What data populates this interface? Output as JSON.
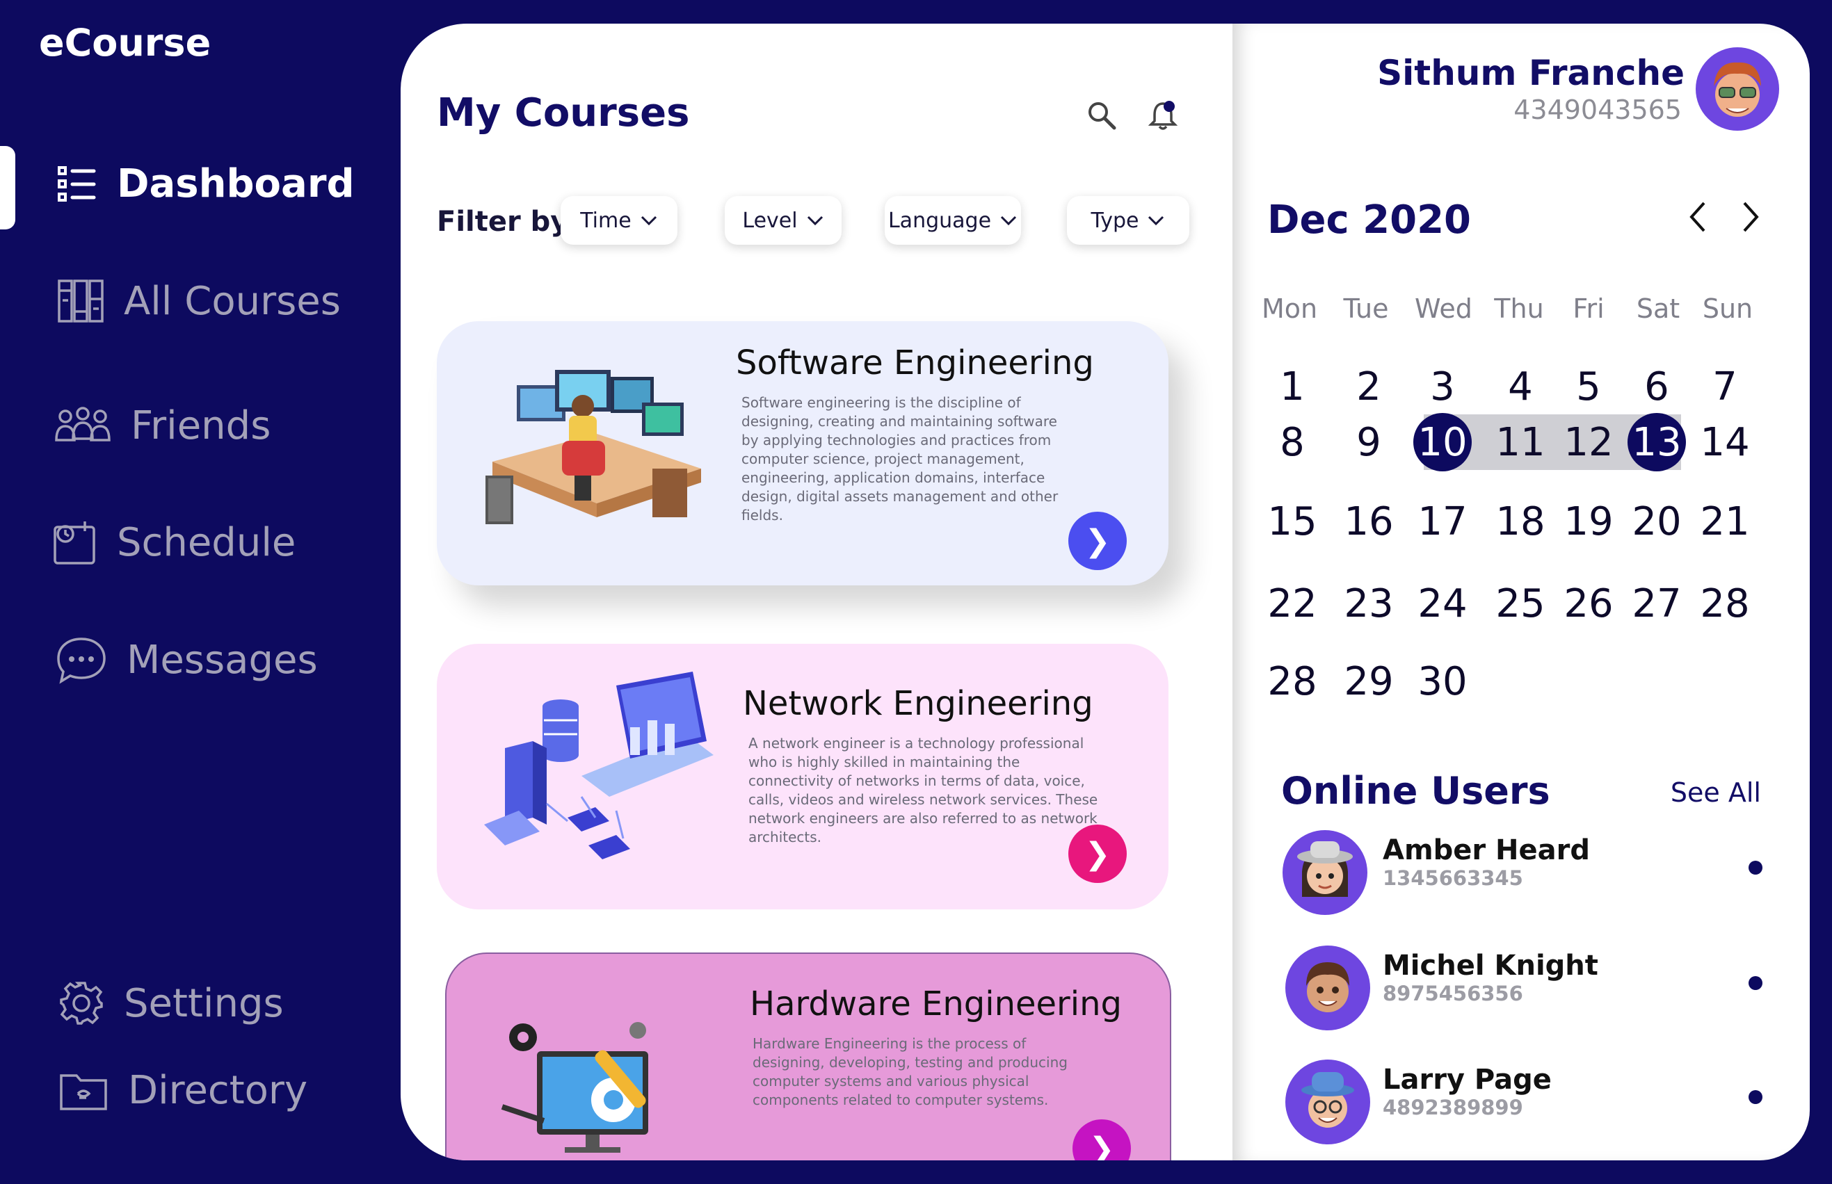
{
  "app": {
    "name": "eCourse"
  },
  "sidebar": {
    "items": [
      {
        "label": "Dashboard",
        "icon": "list-icon",
        "active": true
      },
      {
        "label": "All Courses",
        "icon": "books-icon",
        "active": false
      },
      {
        "label": "Friends",
        "icon": "friends-icon",
        "active": false
      },
      {
        "label": "Schedule",
        "icon": "schedule-icon",
        "active": false
      },
      {
        "label": "Messages",
        "icon": "chat-icon",
        "active": false
      },
      {
        "label": "Settings",
        "icon": "gear-icon",
        "active": false
      },
      {
        "label": "Directory",
        "icon": "folder-icon",
        "active": false
      }
    ]
  },
  "main": {
    "title": "My Courses",
    "filter_label": "Filter by:",
    "filters": [
      "Time",
      "Level",
      "Language",
      "Type"
    ],
    "courses": [
      {
        "title": "Software Engineering",
        "description": "Software engineering is the discipline of designing, creating and maintaining software by applying technologies and practices from computer science, project management, engineering, application domains, interface design, digital assets management and other fields.",
        "button_glyph": "❯",
        "background": "#eceffd",
        "button_color": "#4b4ef0"
      },
      {
        "title": "Network Engineering",
        "description": "A network engineer is a technology professional who is highly skilled in maintaining the connectivity of networks in terms of data, voice, calls, videos and wireless network services. These network engineers are also referred to as network architects.",
        "button_glyph": "❯",
        "background": "#fde3fb",
        "button_color": "#e8177d"
      },
      {
        "title": "Hardware Engineering",
        "description": "Hardware Engineering is the process of designing, developing, testing and producing computer systems and various physical components related to computer systems.",
        "button_glyph": "❯",
        "background": "#e69ad9",
        "button_color": "#c513c2"
      }
    ]
  },
  "profile": {
    "name": "Sithum Franche",
    "id": "4349043565"
  },
  "calendar": {
    "month_label": "Dec 2020",
    "weekdays": [
      "Mon",
      "Tue",
      "Wed",
      "Thu",
      "Fri",
      "Sat",
      "Sun"
    ],
    "weeks": [
      [
        "1",
        "2",
        "3",
        "4",
        "5",
        "6",
        "7"
      ],
      [
        "8",
        "9",
        "10",
        "11",
        "12",
        "13",
        "14"
      ],
      [
        "15",
        "16",
        "17",
        "18",
        "19",
        "20",
        "21"
      ],
      [
        "22",
        "23",
        "24",
        "25",
        "26",
        "27",
        "28"
      ],
      [
        "28",
        "29",
        "30"
      ]
    ],
    "range_start": "10",
    "range_end": "13"
  },
  "online_users": {
    "title": "Online Users",
    "see_all": "See All",
    "users": [
      {
        "name": "Amber Heard",
        "id": "1345663345"
      },
      {
        "name": "Michel Knight",
        "id": "8975456356"
      },
      {
        "name": "Larry Page",
        "id": "4892389899"
      }
    ]
  },
  "colors": {
    "background": "#0d0a5f",
    "primary_text": "#120d66",
    "accent": "#6e46e0"
  }
}
